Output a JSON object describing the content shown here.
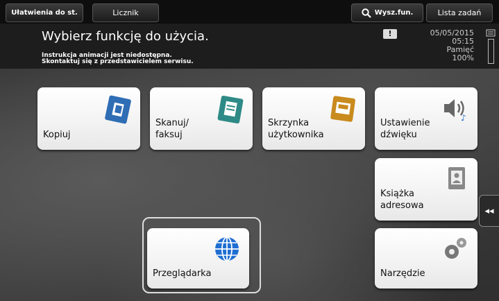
{
  "topbar": {
    "accessibility_label": "Ułatwienia do st.",
    "counter_label": "Licznik",
    "search_label": "Wysz.fun.",
    "jobs_label": "Lista zadań"
  },
  "header": {
    "title": "Wybierz funkcję do użycia.",
    "notice_line1": "Instrukcja animacji jest niedostępna.",
    "notice_line2": "Skontaktuj się z przedstawicielem serwisu.",
    "warning_symbol": "!",
    "date": "05/05/2015",
    "time": "05:15",
    "memory_label": "Pamięć",
    "memory_value": "100%"
  },
  "tiles": {
    "copy": {
      "label": "Kopiuj",
      "icon": "copy-icon"
    },
    "scan": {
      "label_line1": "Skanuj/",
      "label_line2": "faksuj",
      "icon": "scan-fax-icon"
    },
    "user_box": {
      "label_line1": "Skrzynka",
      "label_line2": "użytkownika",
      "icon": "user-box-icon"
    },
    "sound": {
      "label_line1": "Ustawienie",
      "label_line2": "dźwięku",
      "icon": "speaker-icon"
    },
    "address_book": {
      "label_line1": "Książka",
      "label_line2": "adresowa",
      "icon": "address-book-icon"
    },
    "browser": {
      "label": "Przeglądarka",
      "icon": "globe-icon"
    },
    "utility": {
      "label": "Narzędzie",
      "icon": "gears-icon"
    }
  },
  "side_tab": {
    "symbol": "◂◂"
  },
  "colors": {
    "copy_icon": "#2f6db5",
    "scan_icon": "#2e8a86",
    "box_icon": "#c98a1e",
    "globe_icon": "#1f6fd1",
    "topbar_bg": "#0e0e0e"
  }
}
